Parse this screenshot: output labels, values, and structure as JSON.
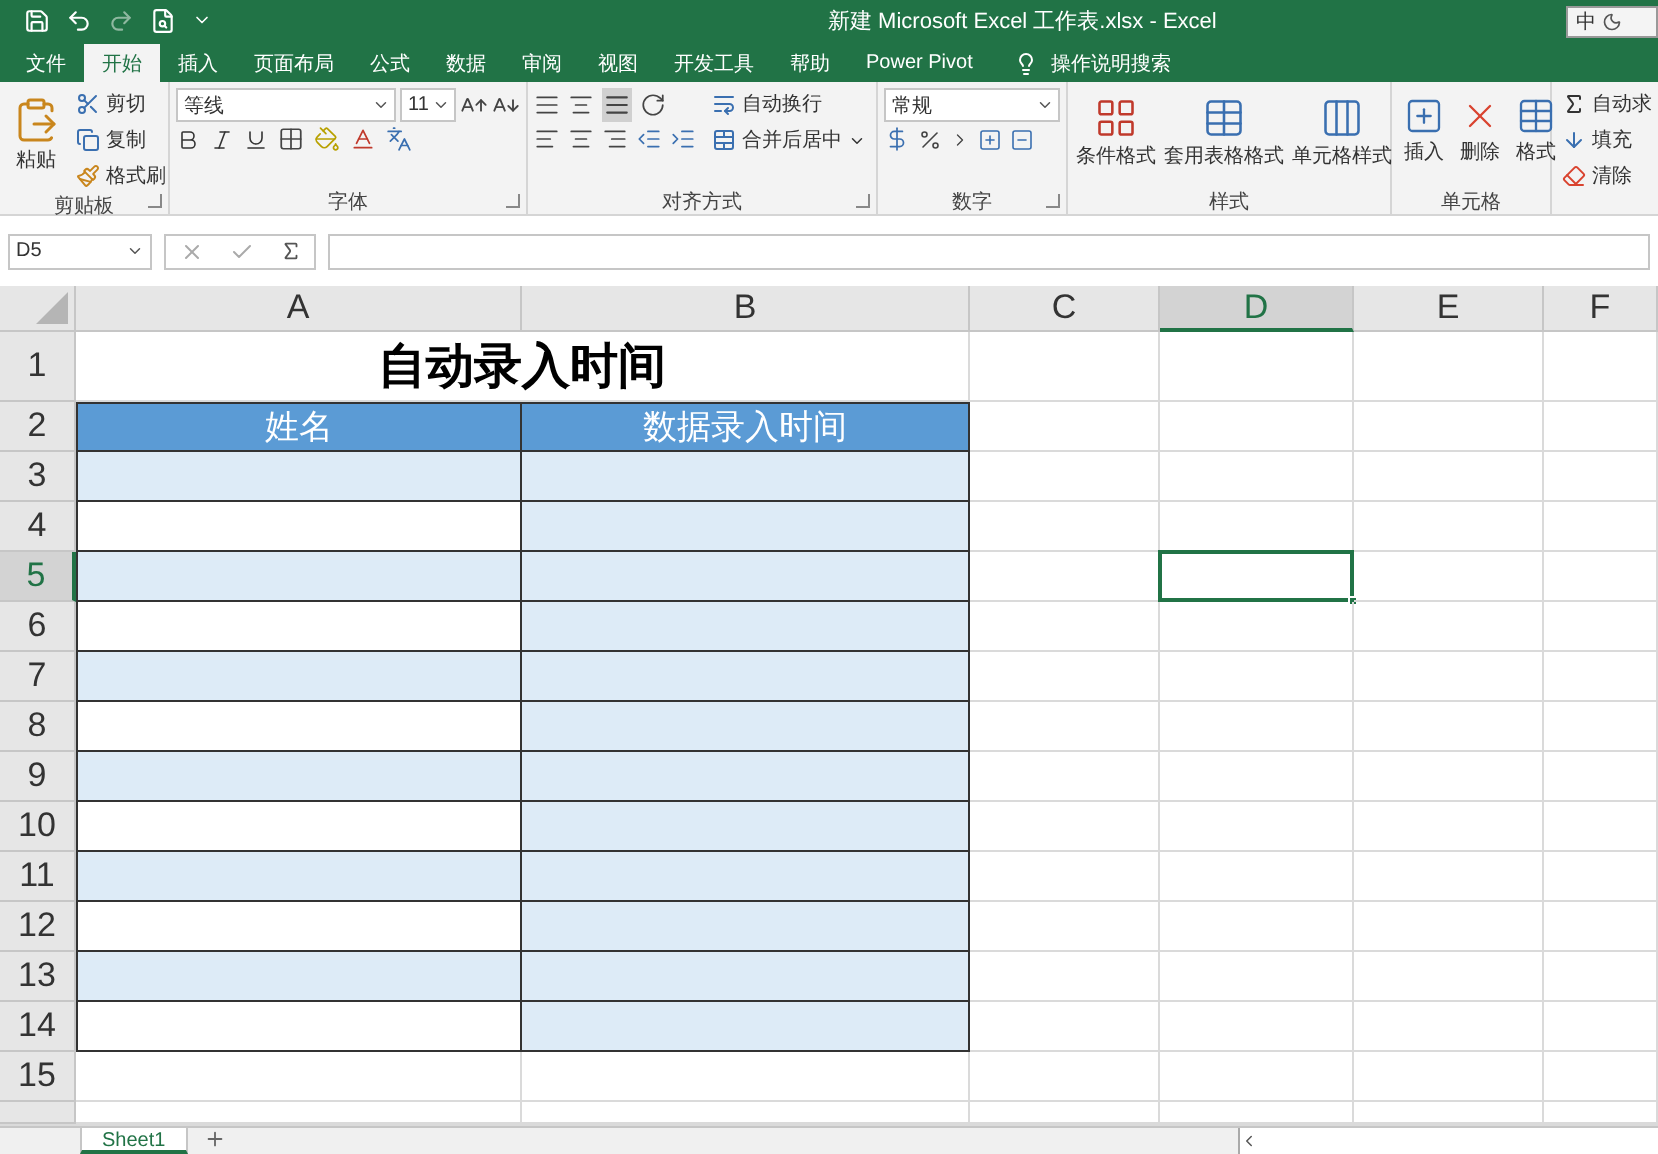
{
  "window": {
    "title": "新建 Microsoft Excel 工作表.xlsx  -  Excel",
    "ime": "中"
  },
  "tabs": [
    {
      "label": "文件",
      "selected": false
    },
    {
      "label": "开始",
      "selected": true
    },
    {
      "label": "插入",
      "selected": false
    },
    {
      "label": "页面布局",
      "selected": false
    },
    {
      "label": "公式",
      "selected": false
    },
    {
      "label": "数据",
      "selected": false
    },
    {
      "label": "审阅",
      "selected": false
    },
    {
      "label": "视图",
      "selected": false
    },
    {
      "label": "开发工具",
      "selected": false
    },
    {
      "label": "帮助",
      "selected": false
    },
    {
      "label": "Power Pivot",
      "selected": false
    }
  ],
  "tell_me": "操作说明搜索",
  "ribbon": {
    "clipboard": {
      "label": "剪贴板",
      "paste": "粘贴",
      "cut": "剪切",
      "copy": "复制",
      "format_painter": "格式刷"
    },
    "font": {
      "label": "字体",
      "font_name": "等线",
      "font_size": "11"
    },
    "alignment": {
      "label": "对齐方式",
      "wrap_text": "自动换行",
      "merge_center": "合并后居中"
    },
    "number": {
      "label": "数字",
      "format": "常规"
    },
    "styles": {
      "label": "样式",
      "items": [
        "条件格式",
        "套用表格格式",
        "单元格样式"
      ]
    },
    "cells": {
      "label": "单元格",
      "items": [
        "插入",
        "删除",
        "格式"
      ]
    },
    "editing": {
      "items": [
        "自动求",
        "填充",
        "清除"
      ]
    }
  },
  "formula_bar": {
    "name_box": "D5"
  },
  "sheet": {
    "columns": [
      {
        "label": "A",
        "selected": false
      },
      {
        "label": "B",
        "selected": false
      },
      {
        "label": "C",
        "selected": false
      },
      {
        "label": "D",
        "selected": true
      },
      {
        "label": "E",
        "selected": false
      },
      {
        "label": "F",
        "selected": false
      }
    ],
    "rows": [
      {
        "label": "1",
        "selected": false,
        "kind": "title",
        "text": "自动录入时间"
      },
      {
        "label": "2",
        "selected": false,
        "kind": "header",
        "cells": [
          "姓名",
          "数据录入时间"
        ]
      },
      {
        "label": "3",
        "selected": false,
        "kind": "data",
        "cells": [
          {
            "shaded": true
          },
          {
            "shaded": true
          }
        ]
      },
      {
        "label": "4",
        "selected": false,
        "kind": "data",
        "cells": [
          {
            "shaded": false
          },
          {
            "shaded": true
          }
        ]
      },
      {
        "label": "5",
        "selected": true,
        "kind": "data",
        "cells": [
          {
            "shaded": true
          },
          {
            "shaded": true
          }
        ]
      },
      {
        "label": "6",
        "selected": false,
        "kind": "data",
        "cells": [
          {
            "shaded": false
          },
          {
            "shaded": true
          }
        ]
      },
      {
        "label": "7",
        "selected": false,
        "kind": "data",
        "cells": [
          {
            "shaded": true
          },
          {
            "shaded": true
          }
        ]
      },
      {
        "label": "8",
        "selected": false,
        "kind": "data",
        "cells": [
          {
            "shaded": false
          },
          {
            "shaded": true
          }
        ]
      },
      {
        "label": "9",
        "selected": false,
        "kind": "data",
        "cells": [
          {
            "shaded": true
          },
          {
            "shaded": true
          }
        ]
      },
      {
        "label": "10",
        "selected": false,
        "kind": "data",
        "cells": [
          {
            "shaded": false
          },
          {
            "shaded": true
          }
        ]
      },
      {
        "label": "11",
        "selected": false,
        "kind": "data",
        "cells": [
          {
            "shaded": true
          },
          {
            "shaded": true
          }
        ]
      },
      {
        "label": "12",
        "selected": false,
        "kind": "data",
        "cells": [
          {
            "shaded": false
          },
          {
            "shaded": true
          }
        ]
      },
      {
        "label": "13",
        "selected": false,
        "kind": "data",
        "cells": [
          {
            "shaded": true
          },
          {
            "shaded": true
          }
        ]
      },
      {
        "label": "14",
        "selected": false,
        "kind": "data",
        "cells": [
          {
            "shaded": false
          },
          {
            "shaded": true
          }
        ]
      },
      {
        "label": "15",
        "selected": false,
        "kind": "blank"
      }
    ]
  },
  "sheet_tabs": [
    {
      "label": "Sheet1",
      "selected": true
    }
  ]
}
